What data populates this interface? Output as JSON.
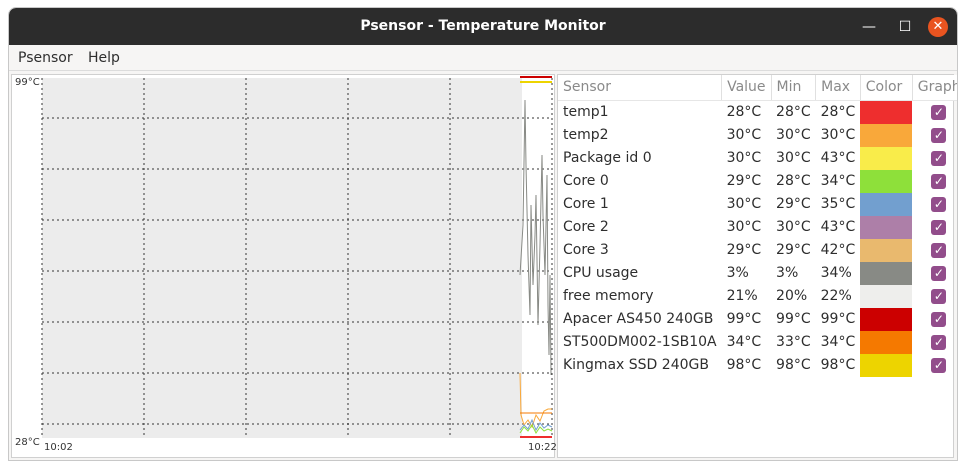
{
  "window": {
    "title": "Psensor - Temperature Monitor",
    "controls": {
      "minimize": "—",
      "maximize": "☐",
      "close": "✕"
    }
  },
  "menu": {
    "items": [
      "Psensor",
      "Help"
    ]
  },
  "graph": {
    "y_max_label": "99°C",
    "y_min_label": "28°C",
    "x_start_label": "10:02",
    "x_end_label": "10:22"
  },
  "table": {
    "headers": [
      "Sensor",
      "Value",
      "Min",
      "Max",
      "Color",
      "Graph"
    ],
    "rows": [
      {
        "sensor": "temp1",
        "value": "28°C",
        "min": "28°C",
        "max": "28°C",
        "color": "#ee2e2e",
        "graph": true
      },
      {
        "sensor": "temp2",
        "value": "30°C",
        "min": "30°C",
        "max": "30°C",
        "color": "#f9a83a",
        "graph": true
      },
      {
        "sensor": "Package id 0",
        "value": "30°C",
        "min": "30°C",
        "max": "43°C",
        "color": "#f9ec4a",
        "graph": true
      },
      {
        "sensor": "Core 0",
        "value": "29°C",
        "min": "28°C",
        "max": "34°C",
        "color": "#8ee03a",
        "graph": true
      },
      {
        "sensor": "Core 1",
        "value": "30°C",
        "min": "29°C",
        "max": "35°C",
        "color": "#729fcf",
        "graph": true
      },
      {
        "sensor": "Core 2",
        "value": "30°C",
        "min": "30°C",
        "max": "43°C",
        "color": "#ad7fa8",
        "graph": true
      },
      {
        "sensor": "Core 3",
        "value": "29°C",
        "min": "29°C",
        "max": "42°C",
        "color": "#e9b96e",
        "graph": true
      },
      {
        "sensor": "CPU usage",
        "value": "3%",
        "min": "3%",
        "max": "34%",
        "color": "#888a85",
        "graph": true
      },
      {
        "sensor": "free memory",
        "value": "21%",
        "min": "20%",
        "max": "22%",
        "color": "#eeeeec",
        "graph": true
      },
      {
        "sensor": "Apacer AS450 240GB",
        "value": "99°C",
        "min": "99°C",
        "max": "99°C",
        "color": "#cc0000",
        "graph": true
      },
      {
        "sensor": "ST500DM002-1SB10A",
        "value": "34°C",
        "min": "33°C",
        "max": "34°C",
        "color": "#f57900",
        "graph": true
      },
      {
        "sensor": "Kingmax SSD 240GB",
        "value": "98°C",
        "min": "98°C",
        "max": "98°C",
        "color": "#edd400",
        "graph": true
      }
    ]
  }
}
